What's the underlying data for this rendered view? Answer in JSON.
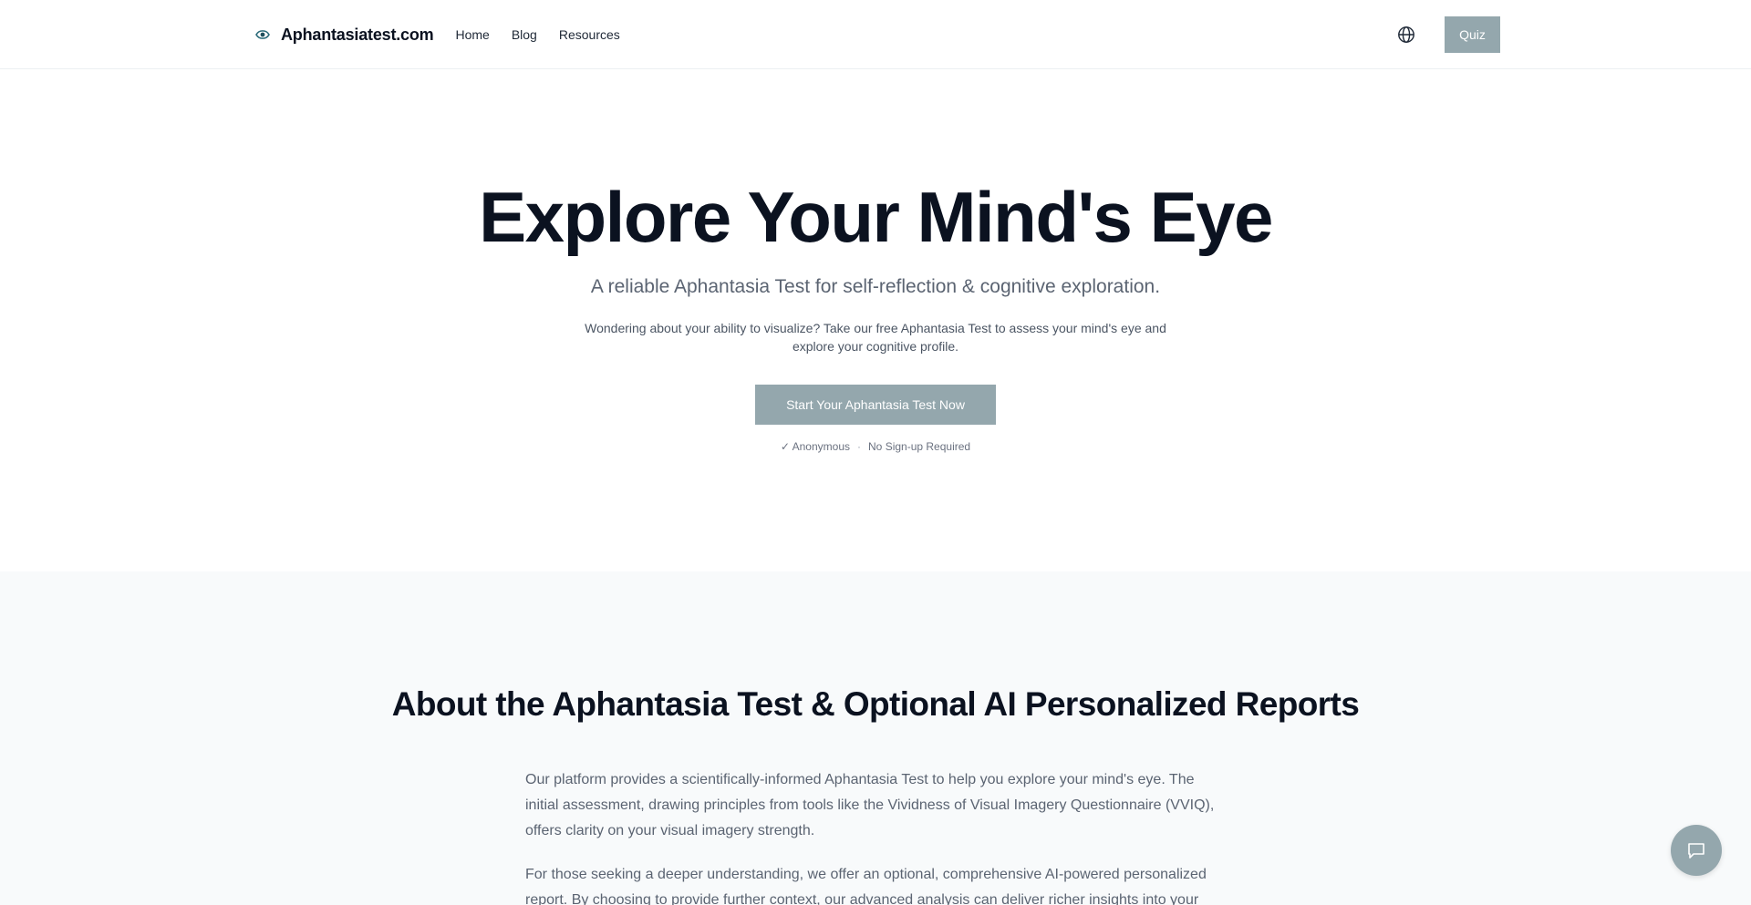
{
  "header": {
    "brand_name": "Aphantasiatest.com",
    "nav": [
      {
        "label": "Home"
      },
      {
        "label": "Blog"
      },
      {
        "label": "Resources"
      }
    ],
    "language_icon": "globe-icon",
    "quiz_label": "Quiz"
  },
  "hero": {
    "title": "Explore Your Mind's Eye",
    "subtitle": "A reliable Aphantasia Test for self-reflection & cognitive exploration.",
    "description": "Wondering about your ability to visualize? Take our free Aphantasia Test to assess your mind's eye and explore your cognitive profile.",
    "cta_label": "Start Your Aphantasia Test Now",
    "note_anonymous": "✓ Anonymous",
    "note_separator": "·",
    "note_signup": "No Sign-up Required"
  },
  "about": {
    "title": "About the Aphantasia Test & Optional AI Personalized Reports",
    "paragraphs": [
      "Our platform provides a scientifically-informed Aphantasia Test to help you explore your mind's eye. The initial assessment, drawing principles from tools like the Vividness of Visual Imagery Questionnaire (VVIQ), offers clarity on your visual imagery strength.",
      "For those seeking a deeper understanding, we offer an optional, comprehensive AI-powered personalized report. By choosing to provide further context, our advanced analysis can deliver richer insights into your"
    ]
  },
  "chat": {
    "icon": "chat-bubble-icon"
  },
  "colors": {
    "accent": "#94a7ad",
    "text_dark": "#0b1220",
    "text_muted": "#5b6472",
    "section_bg": "#f8fafb"
  }
}
